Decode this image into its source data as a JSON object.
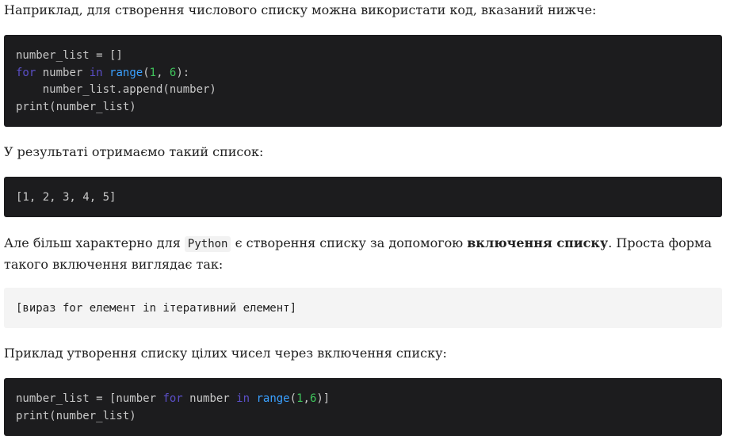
{
  "paragraphs": {
    "p1": "Наприклад, для створення числового списку можна використати код, вказаний нижче:",
    "p2": "У результаті отримаємо такий список:",
    "p3_start": "Але більш характерно для ",
    "p3_code": "Python",
    "p3_mid": " є створення списку за допомогою ",
    "p3_bold": "включення списку",
    "p3_end": ". Проста форма такого включення виглядає так:",
    "p4": "Приклад утворення списку цілих чисел через включення списку:"
  },
  "code1": {
    "l1": "number_list = []",
    "l2_kw1": "for",
    "l2_a": " number ",
    "l2_kw2": "in",
    "l2_sp": " ",
    "l2_fn": "range",
    "l2_p1": "(",
    "l2_n1": "1",
    "l2_c": ", ",
    "l2_n2": "6",
    "l2_p2": "):",
    "l3": "    number_list.append(number)",
    "l4": "print(number_list)"
  },
  "code2": {
    "l1": "[1, 2, 3, 4, 5]"
  },
  "code3": {
    "l1": "[вираз for елемент in ітеративний елемент]"
  },
  "code4": {
    "l1_a": "number_list = [number ",
    "l1_kw1": "for",
    "l1_b": " number ",
    "l1_kw2": "in",
    "l1_sp": " ",
    "l1_fn": "range",
    "l1_p1": "(",
    "l1_n1": "1",
    "l1_c": ",",
    "l1_n2": "6",
    "l1_p2": ")]",
    "l2": "print(number_list)"
  },
  "colors": {
    "code_bg": "#1c1c1e",
    "keyword": "#5b4fc8",
    "function": "#3aa0ff",
    "number": "#3fc55c"
  }
}
